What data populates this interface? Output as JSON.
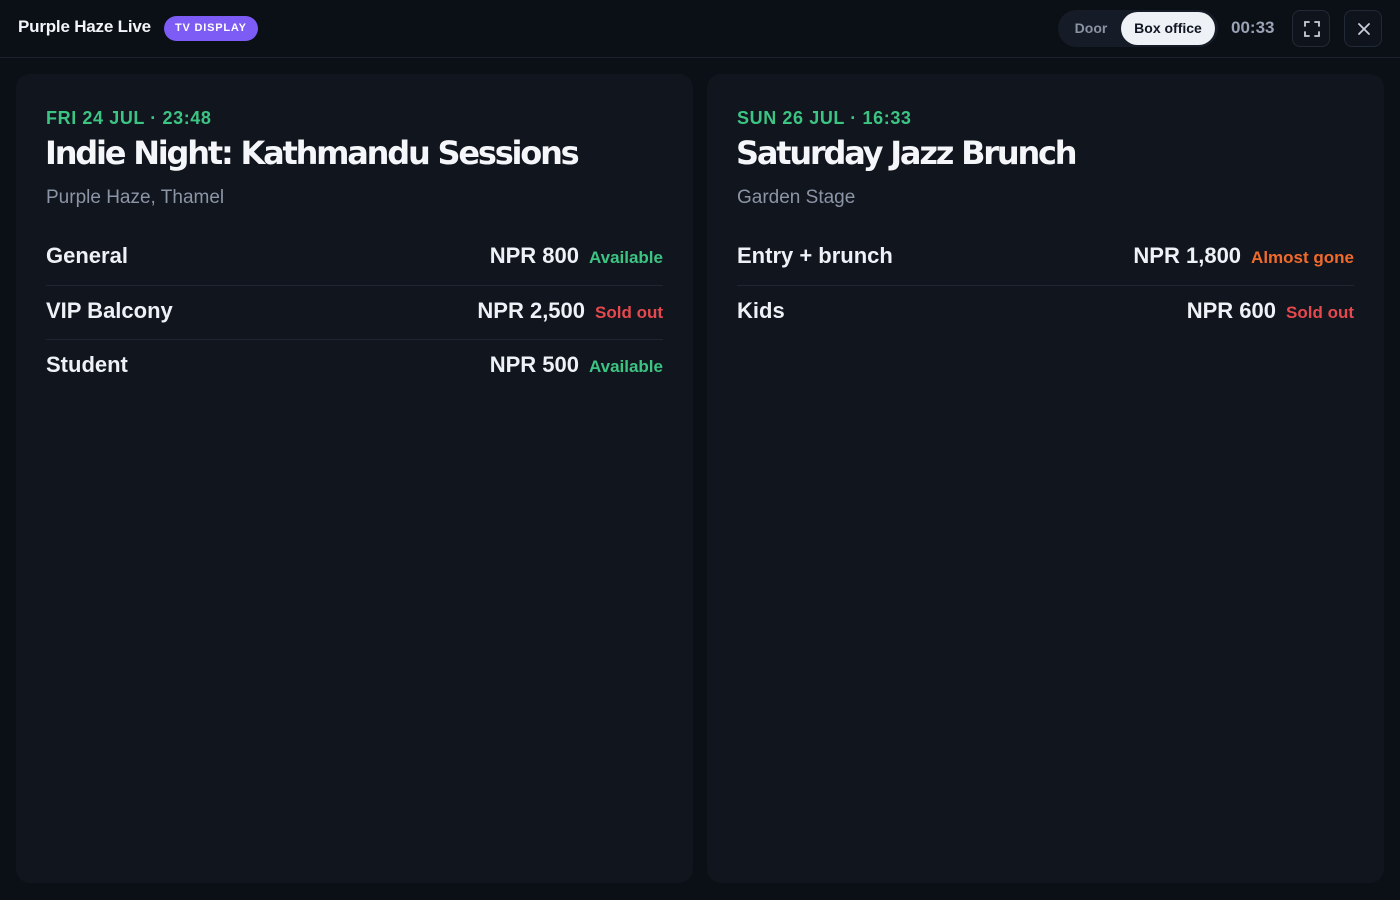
{
  "header": {
    "brand": "Purple Haze Live",
    "badge": "TV DISPLAY",
    "modes": [
      "Door",
      "Box office"
    ],
    "active_mode": "Box office",
    "timer": "00:33",
    "icons": {
      "fullscreen": "fullscreen-icon",
      "close": "close-icon"
    }
  },
  "colors": {
    "accent": "#7c5cf4",
    "date": "#3cc483",
    "available": "#3cc483",
    "sold_out": "#e5484d",
    "almost_gone": "#f06a2c"
  },
  "events": [
    {
      "date": "FRI 24 JUL · 23:48",
      "title": "Indie Night: Kathmandu Sessions",
      "venue": "Purple Haze, Thamel",
      "tiers": [
        {
          "name": "General",
          "price": "NPR 800",
          "status": "Available"
        },
        {
          "name": "VIP Balcony",
          "price": "NPR 2,500",
          "status": "Sold out"
        },
        {
          "name": "Student",
          "price": "NPR 500",
          "status": "Available"
        }
      ]
    },
    {
      "date": "SUN 26 JUL · 16:33",
      "title": "Saturday Jazz Brunch",
      "venue": "Garden Stage",
      "tiers": [
        {
          "name": "Entry + brunch",
          "price": "NPR 1,800",
          "status": "Almost gone"
        },
        {
          "name": "Kids",
          "price": "NPR 600",
          "status": "Sold out"
        }
      ]
    }
  ]
}
